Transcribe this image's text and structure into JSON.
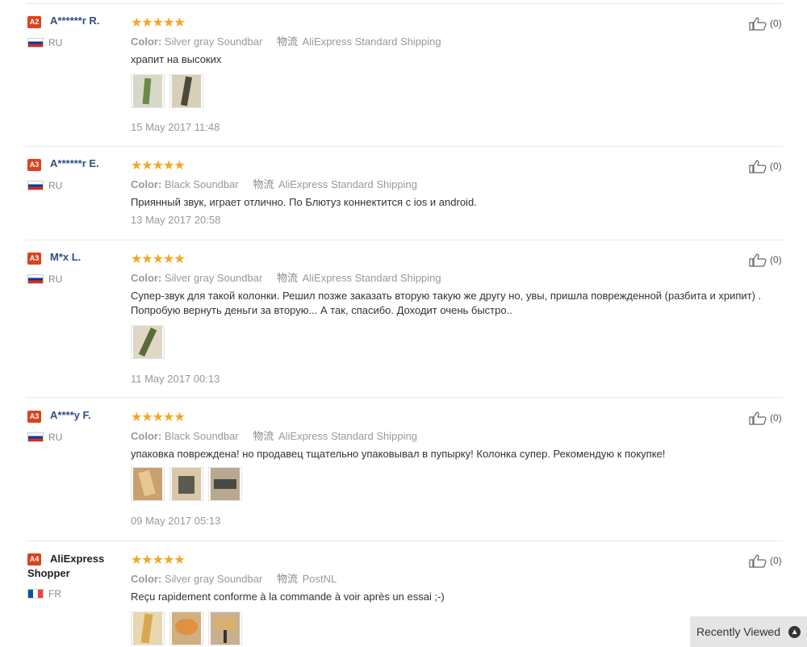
{
  "reviews": [
    {
      "badge": "A2",
      "badge_color": "#d9441f",
      "name": "A******r R.",
      "country": "RU",
      "stars": "★★★★★",
      "color_label": "Color:",
      "color_value": "Silver gray Soundbar",
      "logistics_icon_text": "物流",
      "shipping": "AliExpress Standard Shipping",
      "text": "храпит на высоких",
      "date": "15 May 2017 11:48",
      "likes": "(0)"
    },
    {
      "badge": "A3",
      "badge_color": "#d9441f",
      "name": "A******r E.",
      "country": "RU",
      "stars": "★★★★★",
      "color_label": "Color:",
      "color_value": "Black Soundbar",
      "logistics_icon_text": "物流",
      "shipping": "AliExpress Standard Shipping",
      "text": "Приянный звук, играет отлично. По Блютуз коннектится с ios и android.",
      "date": "13 May 2017 20:58",
      "likes": "(0)"
    },
    {
      "badge": "A3",
      "badge_color": "#d9441f",
      "name": "M*x L.",
      "country": "RU",
      "stars": "★★★★★",
      "color_label": "Color:",
      "color_value": "Silver gray Soundbar",
      "logistics_icon_text": "物流",
      "shipping": "AliExpress Standard Shipping",
      "text": "Супер-звук для такой колонки. Решил позже заказать вторую такую же другу но, увы, пришла поврежденной (разбита и хрипит) . Попробую вернуть деньги за вторую... А так, спасибо. Доходит очень быстро..",
      "date": "11 May 2017 00:13",
      "likes": "(0)"
    },
    {
      "badge": "A3",
      "badge_color": "#d9441f",
      "name": "A****y F.",
      "country": "RU",
      "stars": "★★★★★",
      "color_label": "Color:",
      "color_value": "Black Soundbar",
      "logistics_icon_text": "物流",
      "shipping": "AliExpress Standard Shipping",
      "text": "упаковка повреждена! но продавец тщательно упаковывал в пупырку! Колонка супер. Рекомендую к покупке!",
      "date": "09 May 2017 05:13",
      "likes": "(0)"
    },
    {
      "badge": "A4",
      "badge_color": "#d9441f",
      "name": "AliExpress Shopper",
      "country": "FR",
      "stars": "★★★★★",
      "color_label": "Color:",
      "color_value": "Silver gray Soundbar",
      "logistics_icon_text": "物流",
      "shipping": "PostNL",
      "text": "Reçu rapidement conforme à la commande à voir après un essai ;-)",
      "likes": "(0)"
    }
  ],
  "recently_viewed": "Recently Viewed"
}
